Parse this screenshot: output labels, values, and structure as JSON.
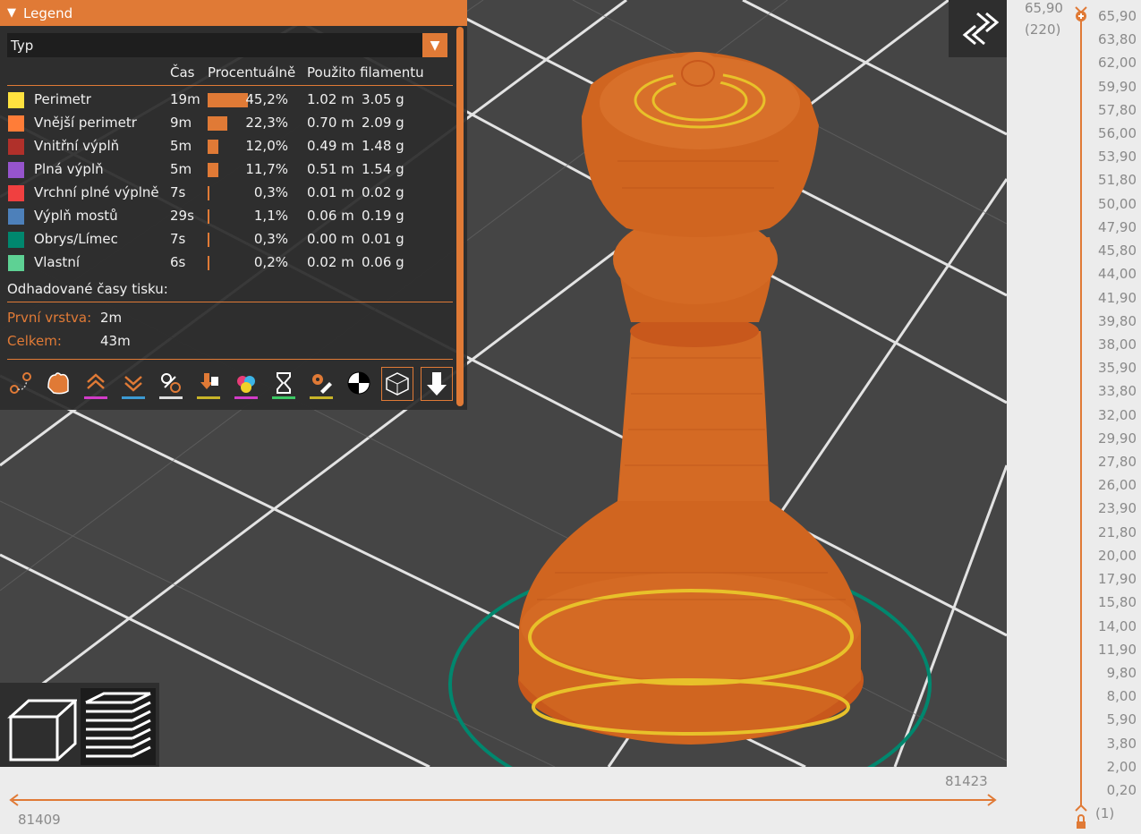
{
  "legend": {
    "title": "Legend",
    "type_value": "Typ",
    "headers": {
      "time": "Čas",
      "percent": "Procentuálně",
      "filament": "Použito filamentu"
    },
    "rows": [
      {
        "name": "Perimetr",
        "time": "19m",
        "percent": "45,2%",
        "fraction": 0.452,
        "meters": "1.02 m",
        "grams": "3.05 g",
        "color": "#ffe23f"
      },
      {
        "name": "Vnější perimetr",
        "time": "9m",
        "percent": "22,3%",
        "fraction": 0.223,
        "meters": "0.70 m",
        "grams": "2.09 g",
        "color": "#ff7d38"
      },
      {
        "name": "Vnitřní výplň",
        "time": "5m",
        "percent": "12,0%",
        "fraction": 0.12,
        "meters": "0.49 m",
        "grams": "1.48 g",
        "color": "#b0302a"
      },
      {
        "name": "Plná výplň",
        "time": "5m",
        "percent": "11,7%",
        "fraction": 0.117,
        "meters": "0.51 m",
        "grams": "1.54 g",
        "color": "#9654cc"
      },
      {
        "name": "Vrchní plné výplně",
        "time": "7s",
        "percent": "0,3%",
        "fraction": 0.003,
        "meters": "0.01 m",
        "grams": "0.02 g",
        "color": "#f04040"
      },
      {
        "name": "Výplň mostů",
        "time": "29s",
        "percent": "1,1%",
        "fraction": 0.011,
        "meters": "0.06 m",
        "grams": "0.19 g",
        "color": "#4d80ba"
      },
      {
        "name": "Obrys/Límec",
        "time": "7s",
        "percent": "0,3%",
        "fraction": 0.003,
        "meters": "0.00 m",
        "grams": "0.01 g",
        "color": "#00876e"
      },
      {
        "name": "Vlastní",
        "time": "6s",
        "percent": "0,2%",
        "fraction": 0.002,
        "meters": "0.02 m",
        "grams": "0.06 g",
        "color": "#5ed194"
      }
    ],
    "estimates_label": "Odhadované časy tisku:",
    "first_layer_label": "První vrstva:",
    "first_layer_value": "2m",
    "total_label": "Celkem:",
    "total_value": "43m",
    "tool_icons": [
      "travel-icon",
      "wipe-icon",
      "retractions-icon",
      "deretractions-icon",
      "seams-icon",
      "tool-changes-icon",
      "color-changes-icon",
      "pause-icon",
      "custom-gcode-icon",
      "center-of-gravity-icon",
      "shells-icon",
      "tool-marker-icon"
    ]
  },
  "vertical_slider": {
    "top_value": "65,90",
    "top_layer": "(220)",
    "bottom_layer": "(1)",
    "ticks": [
      "65,90",
      "63,80",
      "62,00",
      "59,90",
      "57,80",
      "56,00",
      "53,90",
      "51,80",
      "50,00",
      "47,90",
      "45,80",
      "44,00",
      "41,90",
      "39,80",
      "38,00",
      "35,90",
      "33,80",
      "32,00",
      "29,90",
      "27,80",
      "26,00",
      "23,90",
      "21,80",
      "20,00",
      "17,90",
      "15,80",
      "14,00",
      "11,90",
      "9,80",
      "8,00",
      "5,90",
      "3,80",
      "2,00",
      "0,20"
    ]
  },
  "horizontal_slider": {
    "left_value": "81409",
    "right_value": "81423"
  },
  "colors": {
    "accent": "#e07a36",
    "background": "#454545",
    "panel": "#2c2c2c"
  }
}
